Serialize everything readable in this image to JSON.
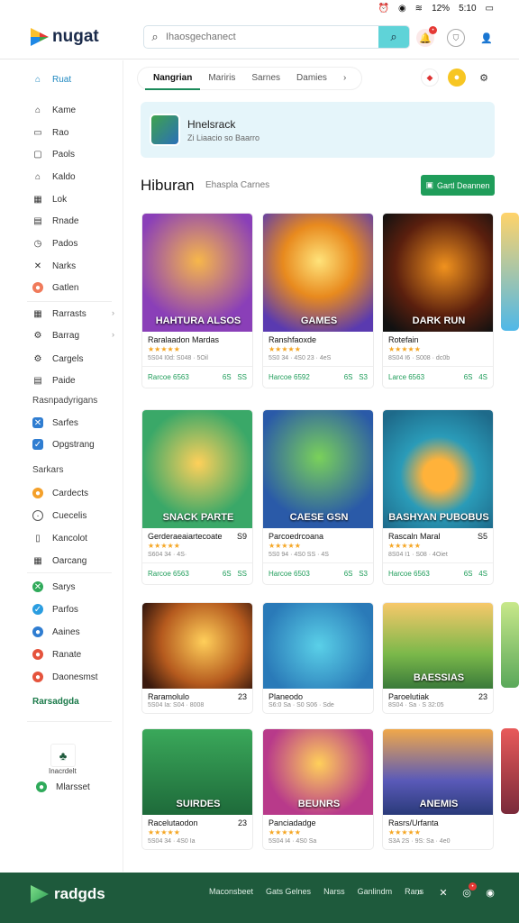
{
  "status": {
    "battery": "12%",
    "time": "5:10"
  },
  "header": {
    "logo": "nugat",
    "search_placeholder": "Ihaosgechanect"
  },
  "sidebar": {
    "home": "Ruat",
    "items": [
      "Kame",
      "Rao",
      "Paols",
      "Kaldo",
      "Lok",
      "Rnade",
      "Pados",
      "Narks",
      "Gatlen"
    ],
    "items2": [
      "Rarrasts",
      "Barrag",
      "Cargels",
      "Paide"
    ],
    "section1": "Rasnpadyrigans",
    "items3": [
      "Sarfes",
      "Opgstrang"
    ],
    "section2": "Sarkars",
    "items4": [
      "Cardects",
      "Cuecelis",
      "Kancolot",
      "Oarcang"
    ],
    "items5": [
      "Sarys",
      "Parfos",
      "Aaines",
      "Ranate",
      "Daonesmst"
    ],
    "green_label": "Rarsadgda",
    "bottom_icon_label": "Inacrdelt",
    "bottom_link": "Mlarsset"
  },
  "tabs": [
    "Nangrian",
    "Mariris",
    "Sarnes",
    "Damies"
  ],
  "banner": {
    "title": "Hnelsrack",
    "subtitle": "Zi Liaacio so Baarro"
  },
  "section": {
    "title": "Hiburan",
    "subtitle": "Ehaspla Carnes",
    "button": "Gartl Deannen"
  },
  "cards": [
    {
      "title": "HAHTURA ALSOS",
      "name": "Raralaadon Mardas",
      "num": "",
      "meta": "5S04 I0d: S048 · 5Oil",
      "price": "Rarcoe 6563",
      "price2": "6S",
      "count": "SS"
    },
    {
      "title": "GAMES",
      "name": "Ranshfaoxde",
      "num": "",
      "meta": "5S0 34 · 4S0 23 · 4eS",
      "price": "Harcoe 6592",
      "price2": "6S",
      "count": "S3"
    },
    {
      "title": "DARK RUN",
      "name": "Rotefain",
      "num": "",
      "meta": "8S04 I6 · S008 · dc0b",
      "price": "Larce 6563",
      "price2": "6S",
      "count": "4S"
    },
    {
      "title": "SNACK PARTE",
      "name": "Gerderaeaiartecoate",
      "num": "S9",
      "meta": "S604 34 · 4S·",
      "price": "Rarcoe 6563",
      "price2": "6S",
      "count": "SS"
    },
    {
      "title": "CAESE GSN",
      "name": "Parcoedrcoana",
      "num": "",
      "meta": "5S0 94 · 4S0 SS · 4S",
      "price": "Harcoe 6503",
      "price2": "6S",
      "count": "S3"
    },
    {
      "title": "BASHYAN PUBOBUS",
      "name": "Rascaln Maral",
      "num": "S5",
      "meta": "8S04 I1 · S08 · 4Oiet",
      "price": "Harcoe 6563",
      "price2": "6S",
      "count": "4S"
    },
    {
      "title": "",
      "name": "Raramolulo",
      "num": "23",
      "meta": "5S04 Ia: S04 · 8008",
      "price": "",
      "price2": "",
      "count": ""
    },
    {
      "title": "",
      "name": "Planeodo",
      "num": "",
      "meta": "S6:0 Sa · S0 S06 · Sde",
      "price": "",
      "price2": "",
      "count": ""
    },
    {
      "title": "BAESSIAS",
      "name": "Paroelutiak",
      "num": "23",
      "meta": "8S04 · Sa · S 32:05",
      "price": "",
      "price2": "",
      "count": ""
    },
    {
      "title": "SUIRDES",
      "name": "Racelutaodon",
      "num": "23",
      "meta": "5S04 34 · 4S0 Ia",
      "price": "",
      "price2": "",
      "count": ""
    },
    {
      "title": "BEUNRS",
      "name": "Panciadadge",
      "num": "",
      "meta": "5S04 I4 · 4S0 Sa",
      "price": "",
      "price2": "",
      "count": ""
    },
    {
      "title": "ANEMIS",
      "name": "Rasrs/Urfanta",
      "num": "",
      "meta": "S3A 2S · 9S: Sa · 4e0",
      "price": "",
      "price2": "",
      "count": ""
    }
  ],
  "footer": {
    "logo": "radgds",
    "links": [
      "Maconsbeet",
      "Gats Gelnes",
      "Narss",
      "Ganlindm",
      "Rans"
    ]
  },
  "colors": {
    "accent": "#1f9d5a",
    "footer": "#1e5a3c",
    "search_btn": "#5fd3d8",
    "banner": "#e5f5fa"
  }
}
